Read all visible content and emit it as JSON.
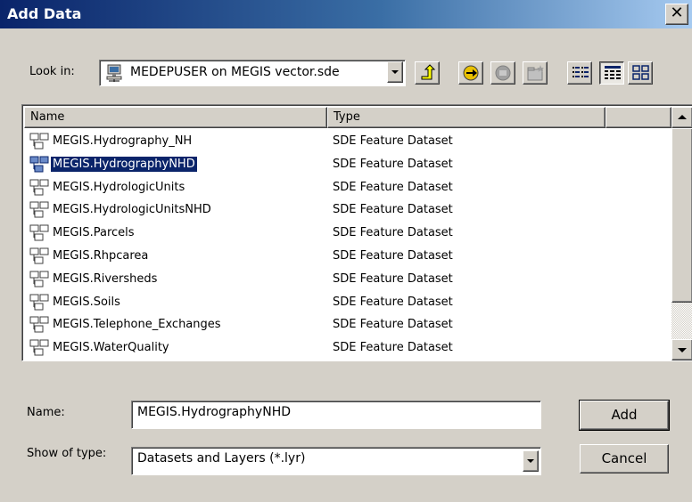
{
  "window": {
    "title": "Add Data"
  },
  "lookin": {
    "label": "Look in:",
    "value": "MEDEPUSER on MEGIS vector.sde"
  },
  "toolbar": {
    "buttons": [
      "up-one-level-icon",
      "connect-to-folder-icon",
      "disconnect-icon",
      "new-folder-icon",
      "list-view-icon",
      "details-view-icon",
      "thumbnails-view-icon"
    ]
  },
  "list": {
    "columns": [
      "Name",
      "Type"
    ],
    "selected_index": 1,
    "items": [
      {
        "name": "MEGIS.Hydrography_NH",
        "type": "SDE Feature Dataset"
      },
      {
        "name": "MEGIS.HydrographyNHD",
        "type": "SDE Feature Dataset"
      },
      {
        "name": "MEGIS.HydrologicUnits",
        "type": "SDE Feature Dataset"
      },
      {
        "name": "MEGIS.HydrologicUnitsNHD",
        "type": "SDE Feature Dataset"
      },
      {
        "name": "MEGIS.Parcels",
        "type": "SDE Feature Dataset"
      },
      {
        "name": "MEGIS.Rhpcarea",
        "type": "SDE Feature Dataset"
      },
      {
        "name": "MEGIS.Riversheds",
        "type": "SDE Feature Dataset"
      },
      {
        "name": "MEGIS.Soils",
        "type": "SDE Feature Dataset"
      },
      {
        "name": "MEGIS.Telephone_Exchanges",
        "type": "SDE Feature Dataset"
      },
      {
        "name": "MEGIS.WaterQuality",
        "type": "SDE Feature Dataset"
      }
    ]
  },
  "form": {
    "name_label": "Name:",
    "name_value": "MEGIS.HydrographyNHD",
    "type_label": "Show of type:",
    "type_value": "Datasets and Layers (*.lyr)",
    "add_label": "Add",
    "cancel_label": "Cancel"
  },
  "colors": {
    "title_bar": "#0a246a",
    "selection": "#0a246a",
    "face": "#d4d0c8"
  }
}
